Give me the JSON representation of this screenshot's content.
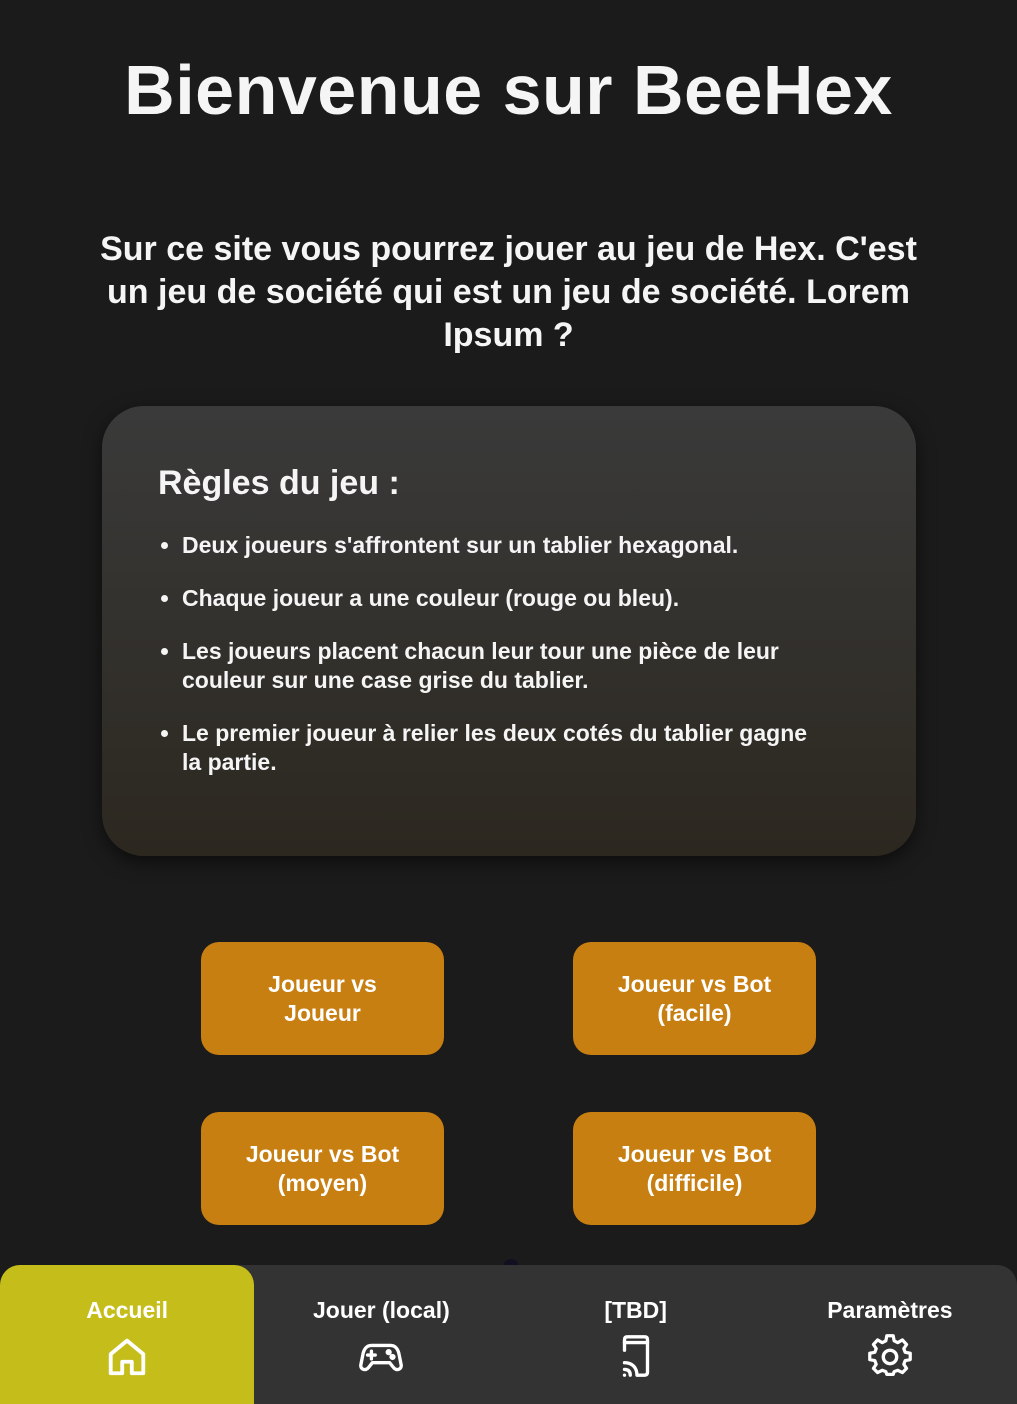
{
  "page": {
    "title": "Bienvenue sur BeeHex",
    "intro": "Sur ce site vous pourrez jouer au jeu de Hex. C'est un jeu de société qui est un jeu de société. Lorem Ipsum ?"
  },
  "rules": {
    "title": "Règles du jeu :",
    "items": [
      "Deux joueurs s'affrontent sur un tablier hexagonal.",
      "Chaque joueur a une couleur (rouge ou bleu).",
      "Les joueurs placent chacun leur tour une pièce de leur couleur sur une case grise du tablier.",
      "Le premier joueur à relier les deux cotés du tablier gagne la partie."
    ]
  },
  "modes": {
    "pvp": "Joueur vs Joueur",
    "bot_easy": "Joueur vs Bot (facile)",
    "bot_medium": "Joueur vs Bot (moyen)",
    "bot_hard": "Joueur vs Bot (difficile)"
  },
  "nav": {
    "items": [
      {
        "label": "Accueil",
        "icon": "home-icon",
        "active": true
      },
      {
        "label": "Jouer (local)",
        "icon": "gamepad-icon",
        "active": false
      },
      {
        "label": "[TBD]",
        "icon": "cast-device-icon",
        "active": false
      },
      {
        "label": "Paramètres",
        "icon": "gear-icon",
        "active": false
      }
    ]
  },
  "colors": {
    "background": "#1b1b1b",
    "button": "#c87f12",
    "nav_active": "#c4bd1a",
    "nav_bar": "#333333"
  }
}
